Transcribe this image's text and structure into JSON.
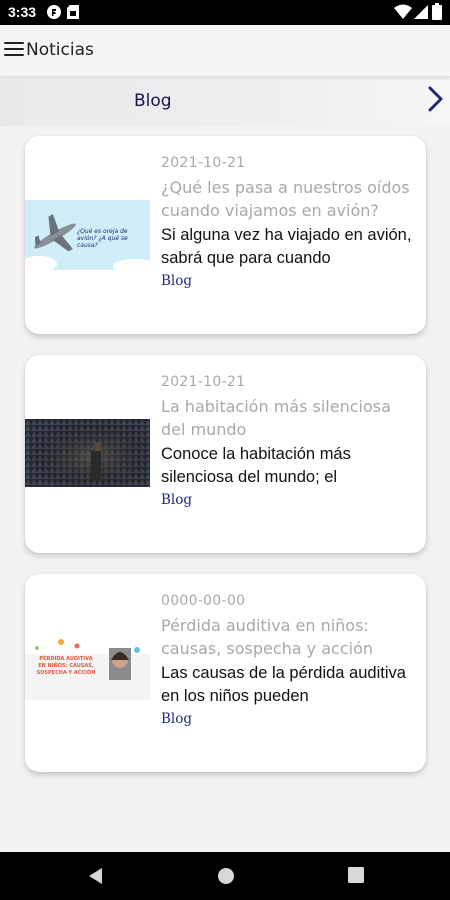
{
  "status_bar": {
    "time": "3:33"
  },
  "app_bar": {
    "title": "Noticias"
  },
  "category_bar": {
    "label": "Blog"
  },
  "articles": [
    {
      "date": "2021-10-21",
      "headline": "¿Qué les pasa a nuestros oídos cuando viajamos en avión?",
      "excerpt": "Si alguna vez ha viajado en avión, sabrá que para cuando",
      "category": "Blog",
      "image_text": "¿Qué es oreja de avión? ¿A qué se causa?"
    },
    {
      "date": "2021-10-21",
      "headline": "La habitación más silenciosa del mundo",
      "excerpt": "Conoce la habitación más silenciosa del mundo; el",
      "category": "Blog"
    },
    {
      "date": "0000-00-00",
      "headline": "Pérdida auditiva en niños: causas, sospecha y acción",
      "excerpt": "Las causas de la pérdida auditiva en los niños pueden",
      "category": "Blog",
      "image_text": "PÉRDIDA AUDITIVA EN NIÑOS: CAUSAS, SOSPECHA Y ACCIÓN"
    }
  ],
  "colors": {
    "category_label": "#16164a",
    "muted_text": "#a8a8a8",
    "tag_text": "#1e2a78",
    "card_bg": "#ffffff",
    "page_bg": "#f2f2f3"
  },
  "icons": {
    "status_left": [
      "shield-icon",
      "sim-card-icon"
    ],
    "status_right": [
      "wifi-icon",
      "cellular-signal-icon",
      "battery-icon"
    ],
    "app_bar": "menu-icon",
    "category_bar": "chevron-right-icon",
    "nav": [
      "back-icon",
      "home-icon",
      "recents-icon"
    ]
  }
}
